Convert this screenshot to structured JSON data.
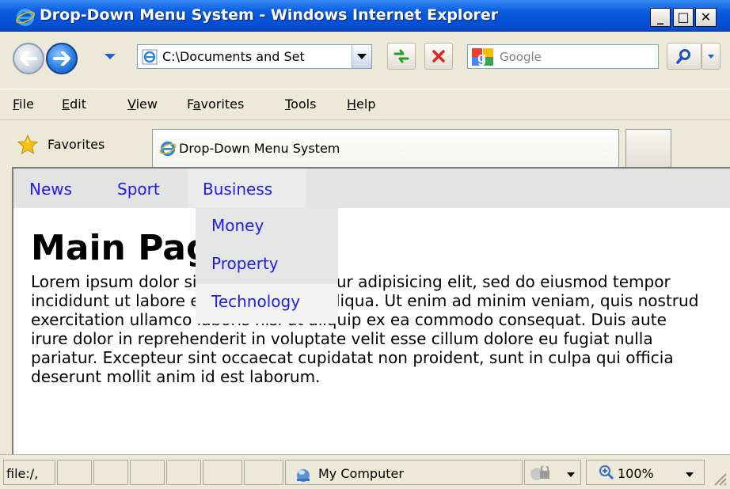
{
  "window": {
    "title": "Drop-Down Menu System - Windows Internet Explorer",
    "minimize": "_",
    "maximize": "□",
    "close": "✕"
  },
  "toolbar": {
    "address": "C:\\Documents and Set",
    "search_placeholder": "Google"
  },
  "menubar": {
    "items": [
      {
        "label": "File",
        "accel": "F",
        "rest": "ile"
      },
      {
        "label": "Edit",
        "accel": "E",
        "rest": "dit"
      },
      {
        "label": "View",
        "accel": "V",
        "rest": "iew"
      },
      {
        "label": "Favorites",
        "accel": "a",
        "pre": "F",
        "rest": "vorites"
      },
      {
        "label": "Tools",
        "accel": "T",
        "rest": "ools"
      },
      {
        "label": "Help",
        "accel": "H",
        "rest": "elp"
      }
    ]
  },
  "favorites": {
    "label": "Favorites",
    "tab_title": "Drop-Down Menu System"
  },
  "page": {
    "nav": [
      "News",
      "Sport",
      "Business"
    ],
    "dropdown": [
      "Money",
      "Property",
      "Technology"
    ],
    "heading": "Main Page",
    "body": "Lorem ipsum dolor sit amet, consectetur adipisicing elit, sed do eiusmod tempor incididunt ut labore et dolore magna aliqua. Ut enim ad minim veniam, quis nostrud exercitation ullamco laboris nisi ut aliquip ex ea commodo consequat. Duis aute irure dolor in reprehenderit in voluptate velit esse cillum dolore eu fugiat nulla pariatur. Excepteur sint occaecat cupidatat non proident, sunt in culpa qui officia deserunt mollit anim id est laborum."
  },
  "status": {
    "url": "file:/,",
    "zone": "My Computer",
    "zoom": "100%"
  },
  "colors": {
    "link": "#1e1ee8",
    "titlebar": "#0551d6",
    "nav_strip": "#e3e3e3"
  }
}
